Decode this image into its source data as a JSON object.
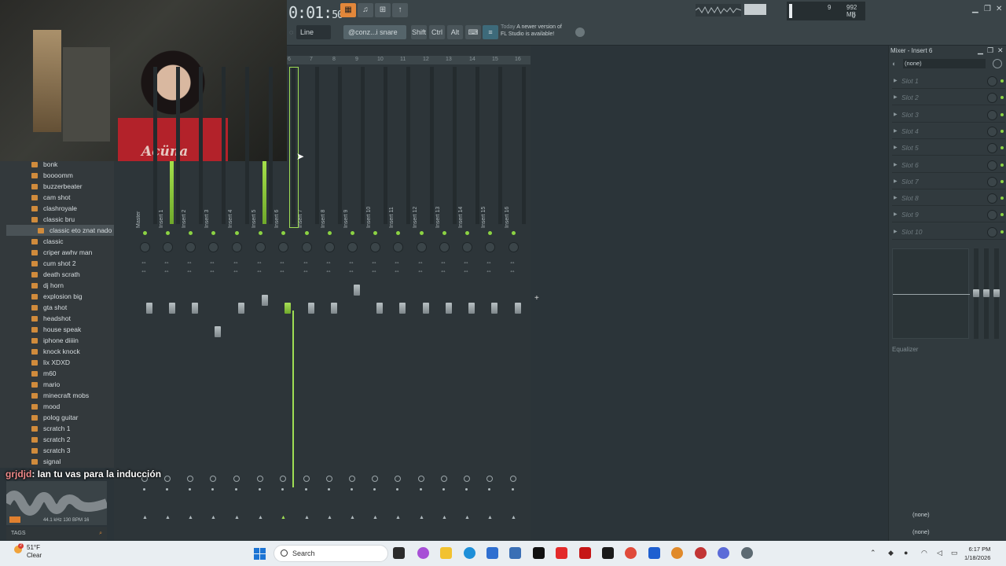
{
  "webcam": {
    "shirt_text": "Acüna"
  },
  "toolbar": {
    "time_main": "0:01:",
    "time_sub": "50",
    "cpu_value": "9",
    "ram_value": "992 MB",
    "poly_value": "0",
    "snap_mode": "Line",
    "pattern": "@conz...i snare",
    "key_shift": "Shift",
    "key_ctrl": "Ctrl",
    "key_alt": "Alt",
    "news_today": "Today",
    "news_text1": "A newer version of",
    "news_text2": "FL Studio is available!"
  },
  "ruler": [
    "6",
    "7",
    "8",
    "9",
    "10",
    "11",
    "12",
    "13",
    "14",
    "15",
    "16"
  ],
  "browser": {
    "items": [
      "bonk",
      "boooomm",
      "buzzerbeater",
      "cam shot",
      "clashroyale",
      "classic bru",
      "classic eto znat nado",
      "classic",
      "criper awhv man",
      "cum shot 2",
      "death scrath",
      "dj horn",
      "explosion big",
      "gta shot",
      "headshot",
      "house speak",
      "iphone diiiin",
      "knock knock",
      "lix XDXD",
      "m60",
      "mario",
      "minecraft mobs",
      "mood",
      "polog guitar",
      "scratch 1",
      "scratch 2",
      "scratch 3",
      "signal"
    ],
    "selected_index": 6,
    "wave_info": "44.1 kHz 130 BPM 16",
    "tags_label": "TAGS"
  },
  "chat": {
    "user": "grjdjd",
    "message": ": Ian tu vas para la inducción"
  },
  "mixer": {
    "tracks": [
      "Master",
      "Insert 1",
      "Insert 2",
      "Insert 3",
      "Insert 4",
      "Insert 5",
      "Insert 6",
      "Insert 7",
      "Insert 8",
      "Insert 9",
      "Insert 10",
      "Insert 11",
      "Insert 12",
      "Insert 13",
      "Insert 14",
      "Insert 15",
      "Insert 16"
    ],
    "selected_track": "Insert 6",
    "active_color": "#9fde54"
  },
  "insert_panel": {
    "title": "Mixer - Insert 6",
    "input": "(none)",
    "slots": [
      "Slot 1",
      "Slot 2",
      "Slot 3",
      "Slot 4",
      "Slot 5",
      "Slot 6",
      "Slot 7",
      "Slot 8",
      "Slot 9",
      "Slot 10"
    ],
    "eq_label": "Equalizer",
    "out1": "(none)",
    "out2": "(none)"
  },
  "taskbar": {
    "temperature": "51°F",
    "condition": "Clear",
    "weather_badge": "2",
    "search_label": "Search",
    "time": "6:17 PM",
    "date": "1/18/2026"
  }
}
